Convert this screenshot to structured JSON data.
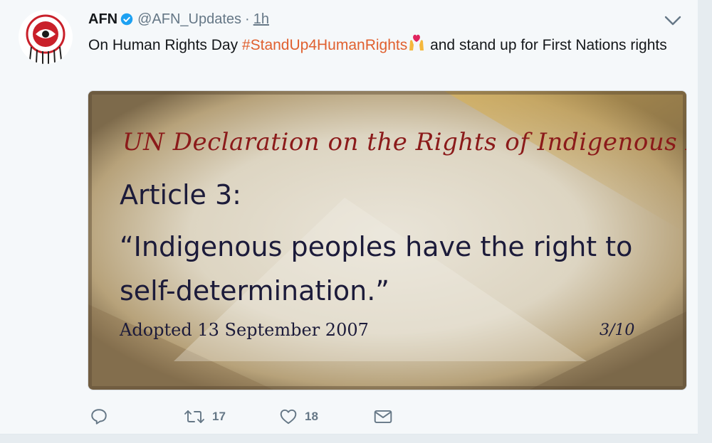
{
  "tweet": {
    "name": "AFN",
    "handle": "@AFN_Updates",
    "separator": "·",
    "time": "1h",
    "text_before": "On Human Rights Day ",
    "hashtag": "#StandUp4HumanRights",
    "text_after": " and stand up for First Nations rights"
  },
  "media": {
    "heading": "UN Declaration on the Rights of Indigenous Peoples",
    "article": "Article 3:",
    "quote": "“Indigenous peoples have the right to self-determination.”",
    "adopted": "Adopted 13 September 2007",
    "page": "3/10"
  },
  "actions": {
    "retweets": "17",
    "likes": "18"
  },
  "icons": [
    "verified-icon",
    "caret-down-icon",
    "reply-icon",
    "retweet-icon",
    "like-icon",
    "message-icon"
  ],
  "colors": {
    "link": "#e0602f",
    "verified": "#1da1f2",
    "muted": "#657786",
    "heading": "#8b1a1a"
  }
}
